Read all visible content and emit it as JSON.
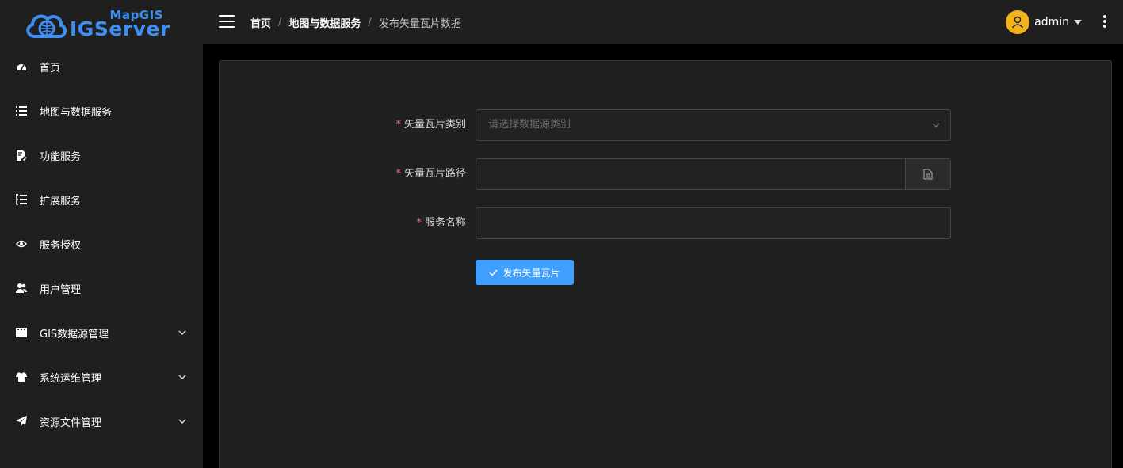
{
  "logo": {
    "top_text": "MapGIS",
    "main_text": "IGServer"
  },
  "sidebar": {
    "items": [
      {
        "label": "首页",
        "icon": "dashboard-icon",
        "has_submenu": false
      },
      {
        "label": "地图与数据服务",
        "icon": "list-icon",
        "has_submenu": false
      },
      {
        "label": "功能服务",
        "icon": "document-edit-icon",
        "has_submenu": false
      },
      {
        "label": "扩展服务",
        "icon": "list-tree-icon",
        "has_submenu": false
      },
      {
        "label": "服务授权",
        "icon": "eye-icon",
        "has_submenu": false
      },
      {
        "label": "用户管理",
        "icon": "users-icon",
        "has_submenu": false
      },
      {
        "label": "GIS数据源管理",
        "icon": "film-icon",
        "has_submenu": true
      },
      {
        "label": "系统运维管理",
        "icon": "shirt-icon",
        "has_submenu": true
      },
      {
        "label": "资源文件管理",
        "icon": "paper-plane-icon",
        "has_submenu": true
      }
    ]
  },
  "header": {
    "breadcrumb": [
      "首页",
      "地图与数据服务",
      "发布矢量瓦片数据"
    ],
    "separator": "/",
    "user": "admin"
  },
  "form": {
    "fields": [
      {
        "label": "矢量瓦片类别",
        "required": true,
        "type": "select",
        "placeholder": "请选择数据源类别",
        "value": ""
      },
      {
        "label": "矢量瓦片路径",
        "required": true,
        "type": "file",
        "placeholder": "",
        "value": ""
      },
      {
        "label": "服务名称",
        "required": true,
        "type": "text",
        "placeholder": "",
        "value": ""
      }
    ],
    "required_mark": "*",
    "submit_label": "发布矢量瓦片"
  },
  "colors": {
    "accent": "#409eff",
    "brand": "#3d8ff5",
    "avatar": "#f2b21b",
    "required": "#f56c6c"
  }
}
